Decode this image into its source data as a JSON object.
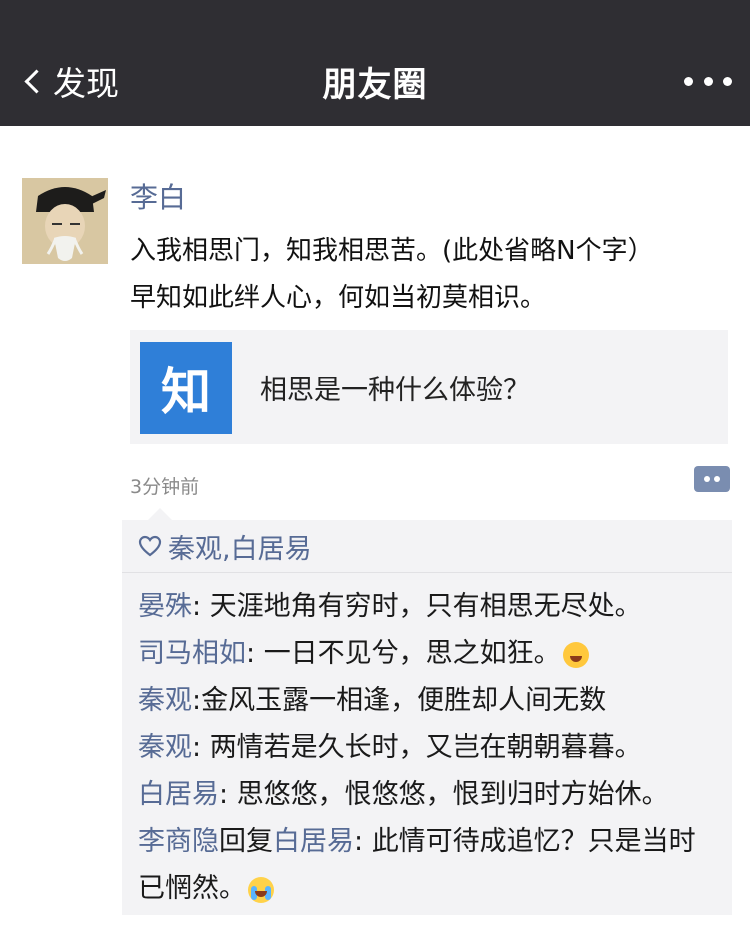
{
  "nav": {
    "back_label": "发现",
    "title": "朋友圈"
  },
  "post": {
    "author": "李白",
    "text_line1": "入我相思门，知我相思苦。(此处省略N个字）",
    "text_line2": "早知如此绊人心，何如当初莫相识。",
    "link": {
      "logo_text": "知",
      "title": "相思是一种什么体验？"
    },
    "time": "3分钟前"
  },
  "likes": {
    "names": "秦观,白居易"
  },
  "comments": [
    {
      "user": "晏殊",
      "sep": ": ",
      "text": "天涯地角有穷时，只有相思无尽处。"
    },
    {
      "user": "司马相如",
      "sep": ": ",
      "text": "一日不见兮，思之如狂。",
      "emoji": "grinning-tears"
    },
    {
      "user": "秦观",
      "sep": ":",
      "text": "金风玉露一相逢，便胜却人间无数"
    },
    {
      "user": "秦观",
      "sep": ": ",
      "text": "两情若是久长时，又岂在朝朝暮暮。"
    },
    {
      "user": "白居易",
      "sep": ": ",
      "text": "思悠悠，恨悠悠，恨到归时方始休。"
    },
    {
      "user": "李商隐",
      "reply_word": "回复",
      "reply_to": "白居易",
      "sep": ": ",
      "text": "此情可待成追忆？只是当时已惘然。",
      "emoji": "crying-face"
    }
  ],
  "colors": {
    "nav_bg": "#2f2e33",
    "name_blue": "#576b95",
    "zhihu_blue": "#2f7fd8"
  }
}
